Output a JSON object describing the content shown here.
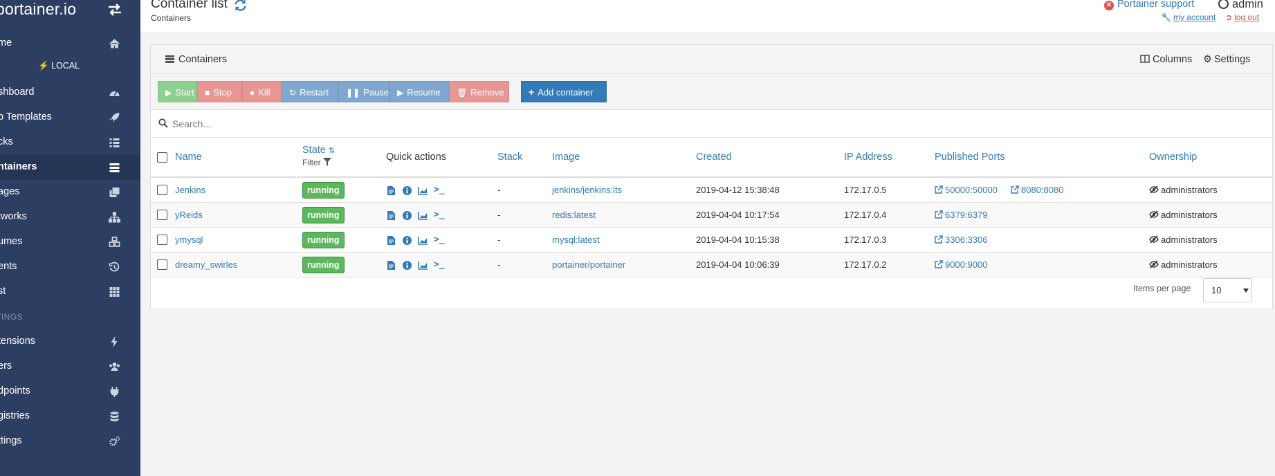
{
  "sidebar": {
    "brand": "portainer.io",
    "endpoint": "LOCAL",
    "items": [
      {
        "label": "me"
      },
      {
        "label": "shboard"
      },
      {
        "label": "p Templates"
      },
      {
        "label": "cks"
      },
      {
        "label": "ntainers"
      },
      {
        "label": "ages"
      },
      {
        "label": "tworks"
      },
      {
        "label": "umes"
      },
      {
        "label": "ents"
      },
      {
        "label": "st"
      }
    ],
    "section": "TINGS",
    "settings_items": [
      {
        "label": "tensions"
      },
      {
        "label": "ers"
      },
      {
        "label": "dpoints"
      },
      {
        "label": "gistries"
      },
      {
        "label": "ttings"
      }
    ]
  },
  "header": {
    "title": "Container list",
    "breadcrumb": "Containers",
    "support": "Portainer support",
    "user": "admin",
    "my_account": "my account",
    "log_out": "log out"
  },
  "widget": {
    "title": "Containers",
    "columns": "Columns",
    "settings": "Settings"
  },
  "toolbar": {
    "start": "Start",
    "stop": "Stop",
    "kill": "Kill",
    "restart": "Restart",
    "pause": "Pause",
    "resume": "Resume",
    "remove": "Remove",
    "add": "Add container"
  },
  "search": {
    "placeholder": "Search..."
  },
  "table": {
    "headers": {
      "name": "Name",
      "state": "State",
      "filter": "Filter",
      "quick_actions": "Quick actions",
      "stack": "Stack",
      "image": "Image",
      "created": "Created",
      "ip": "IP Address",
      "ports": "Published Ports",
      "ownership": "Ownership"
    },
    "rows": [
      {
        "name": "Jenkins",
        "state": "running",
        "stack": "-",
        "image": "jenkins/jenkins:lts",
        "created": "2019-04-12 15:38:48",
        "ip": "172.17.0.5",
        "port1": "50000:50000",
        "port2": "8080:8080",
        "ownership": "administrators"
      },
      {
        "name": "yReids",
        "state": "running",
        "stack": "-",
        "image": "redis:latest",
        "created": "2019-04-04 10:17:54",
        "ip": "172.17.0.4",
        "port1": "6379:6379",
        "port2": "",
        "ownership": "administrators"
      },
      {
        "name": "ymysql",
        "state": "running",
        "stack": "-",
        "image": "mysql:latest",
        "created": "2019-04-04 10:15:38",
        "ip": "172.17.0.3",
        "port1": "3306:3306",
        "port2": "",
        "ownership": "administrators"
      },
      {
        "name": "dreamy_swirles",
        "state": "running",
        "stack": "-",
        "image": "portainer/portainer",
        "created": "2019-04-04 10:06:39",
        "ip": "172.17.0.2",
        "port1": "9000:9000",
        "port2": "",
        "ownership": "administrators"
      }
    ]
  },
  "footer": {
    "items_per_page_label": "Items per page",
    "items_per_page": "10"
  },
  "colors": {
    "sidebar_bg": "#2d3e63",
    "link": "#337ab7",
    "running": "#5cb85c",
    "primary": "#337ab7",
    "danger": "#d9534f"
  }
}
